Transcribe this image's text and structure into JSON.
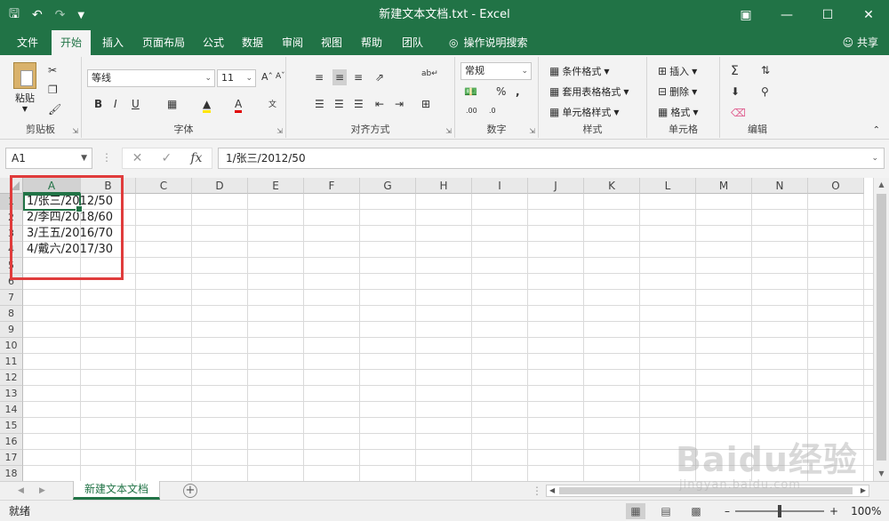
{
  "window": {
    "title": "新建文本文档.txt  -  Excel"
  },
  "tabs": [
    {
      "label": "文件",
      "active": false
    },
    {
      "label": "开始",
      "active": true
    },
    {
      "label": "插入",
      "active": false
    },
    {
      "label": "页面布局",
      "active": false
    },
    {
      "label": "公式",
      "active": false
    },
    {
      "label": "数据",
      "active": false
    },
    {
      "label": "审阅",
      "active": false
    },
    {
      "label": "视图",
      "active": false
    },
    {
      "label": "帮助",
      "active": false
    },
    {
      "label": "团队",
      "active": false
    }
  ],
  "tell_me": "操作说明搜索",
  "share": "共享",
  "ribbon": {
    "clipboard": {
      "paste": "粘贴",
      "label": "剪贴板"
    },
    "font": {
      "name": "等线",
      "size": "11",
      "label": "字体"
    },
    "alignment": {
      "label": "对齐方式"
    },
    "number": {
      "format": "常规",
      "label": "数字"
    },
    "styles": {
      "conditional": "条件格式",
      "table": "套用表格格式",
      "cell_styles": "单元格样式",
      "label": "样式"
    },
    "cells": {
      "insert": "插入",
      "delete": "删除",
      "format": "格式",
      "label": "单元格"
    },
    "editing": {
      "label": "编辑"
    }
  },
  "formula_bar": {
    "name_box": "A1",
    "formula": "1/张三/2012/50"
  },
  "columns": [
    "A",
    "B",
    "C",
    "D",
    "E",
    "F",
    "G",
    "H",
    "I",
    "J",
    "K",
    "L",
    "M",
    "N",
    "O"
  ],
  "rows": [
    "1",
    "2",
    "3",
    "4",
    "5",
    "6",
    "7",
    "8",
    "9",
    "10",
    "11",
    "12",
    "13",
    "14",
    "15",
    "16",
    "17",
    "18"
  ],
  "cells": {
    "A1": "1/张三/2012/50",
    "A2": "2/李四/2018/60",
    "A3": "3/王五/2016/70",
    "A4": "4/戴六/2017/30"
  },
  "sheet_tab": "新建文本文档",
  "status": {
    "ready": "就绪",
    "zoom": "100%"
  },
  "watermark": {
    "text": "Baidu经验",
    "url": "jingyan.baidu.com"
  },
  "colors": {
    "excel_green": "#217346",
    "highlight_red": "#e03c3c"
  }
}
